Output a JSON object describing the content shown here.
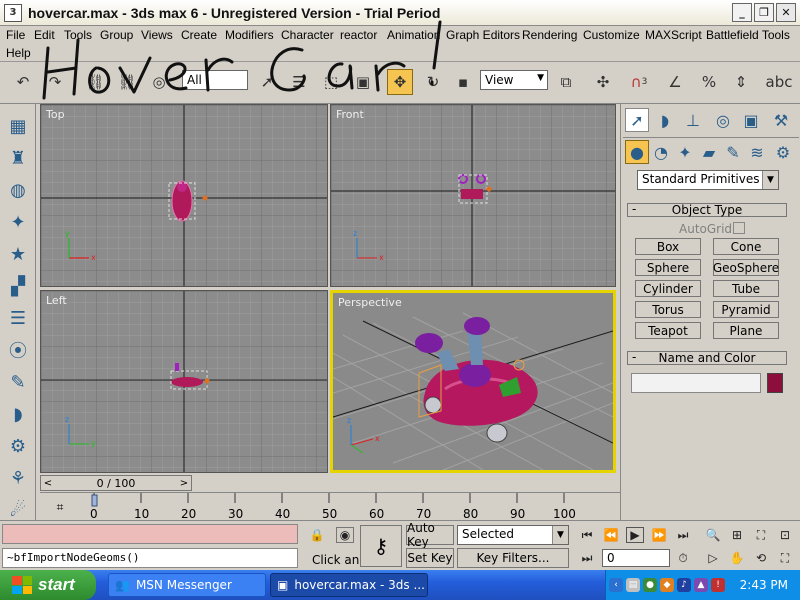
{
  "window": {
    "title": "hovercar.max - 3ds max 6 - Unregistered Version - Trial Period",
    "app_icon": "3ds-max-icon",
    "minimize": "_",
    "restore": "❐",
    "close": "✕"
  },
  "menu": {
    "items": [
      "File",
      "Edit",
      "Tools",
      "Group",
      "Views",
      "Create",
      "Modifiers",
      "Character",
      "reactor",
      "Animation",
      "Graph Editors",
      "Rendering",
      "Customize",
      "MAXScript",
      "Battlefield Tools",
      "Help"
    ],
    "overlay_scribble": "Hover Car!"
  },
  "toolbar": {
    "selection_filter": "All",
    "ref_coord": "View",
    "snap_3": "3"
  },
  "viewports": [
    {
      "label": "Top"
    },
    {
      "label": "Front"
    },
    {
      "label": "Left"
    },
    {
      "label": "Perspective",
      "active": true
    }
  ],
  "time_slider": {
    "text": "0 / 100",
    "prev": "<",
    "next": ">"
  },
  "track_ruler": {
    "ticks": [
      "0",
      "10",
      "20",
      "30",
      "40",
      "50",
      "60",
      "70",
      "80",
      "90",
      "100"
    ]
  },
  "status": {
    "maxscript_mini_listener": "",
    "listener_text": "~bfImportNodeGeoms()",
    "click_and_text": "Click and",
    "auto_key": "Auto Key",
    "set_key": "Set Key",
    "selected_dropdown": "Selected",
    "key_filters": "Key Filters...",
    "frame_value": "0"
  },
  "command_panel": {
    "dropdown": "Standard Primitives",
    "object_type_header": "Object Type",
    "autogrid_label": "AutoGrid",
    "buttons": [
      "Box",
      "Cone",
      "Sphere",
      "GeoSphere",
      "Cylinder",
      "Tube",
      "Torus",
      "Pyramid",
      "Teapot",
      "Plane"
    ],
    "name_color_header": "Name and Color",
    "color_swatch": "#8b0f3a"
  },
  "taskbar": {
    "start_label": "start",
    "tasks": [
      "MSN Messenger",
      "hovercar.max - 3ds ..."
    ],
    "clock": "2:43 PM"
  }
}
